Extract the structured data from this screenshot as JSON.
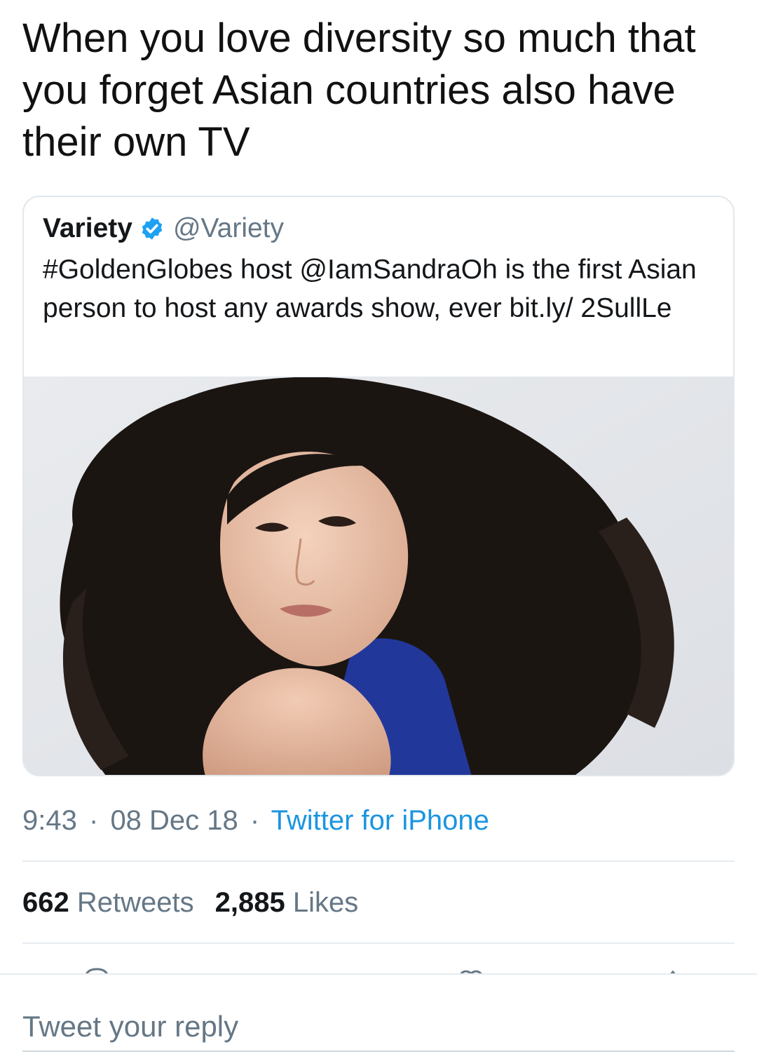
{
  "tweet": {
    "text": "When you love diversity so much that you forget Asian countries also have their own TV"
  },
  "quoted_tweet": {
    "name": "Variety",
    "verified_icon": "verified-badge-icon",
    "handle": "@Variety",
    "text": "#GoldenGlobes host @IamSandraOh is the first Asian person to host any awards show, ever bit.ly/ 2SullLe",
    "image": "portrait-photo"
  },
  "meta": {
    "time": "9:43",
    "separator": "·",
    "date": "08 Dec 18",
    "source": "Twitter for iPhone"
  },
  "stats": {
    "retweets_count": "662",
    "retweets_label": "Retweets",
    "likes_count": "2,885",
    "likes_label": "Likes"
  },
  "reply": {
    "placeholder": "Tweet your reply"
  },
  "colors": {
    "link": "#1b95e0",
    "secondary_text": "#657786",
    "verified": "#1da1f2",
    "border": "#e1e8ed"
  }
}
